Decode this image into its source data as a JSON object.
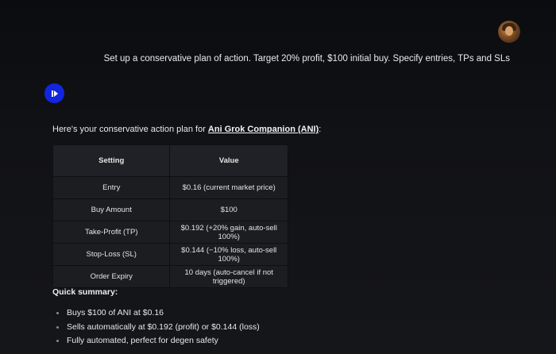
{
  "user": {
    "avatar_icon": "user-avatar-icon",
    "message": "Set up a conservative plan of action. Target 20% profit, $100 initial buy. Specify entries, TPs and SLs"
  },
  "assistant": {
    "icon": "grok-logo-icon",
    "accent": "#1226e0",
    "intro_prefix": "Here's your conservative action plan for ",
    "intro_link": "Ani Grok Companion (ANI)",
    "intro_suffix": ":"
  },
  "table": {
    "headers": [
      "Setting",
      "Value"
    ],
    "rows": [
      {
        "setting": "Entry",
        "value": "$0.16 (current market price)"
      },
      {
        "setting": "Buy Amount",
        "value": "$100"
      },
      {
        "setting": "Take-Profit (TP)",
        "value": "$0.192 (+20% gain, auto-sell 100%)"
      },
      {
        "setting": "Stop-Loss (SL)",
        "value": "$0.144 (−10% loss, auto-sell 100%)"
      },
      {
        "setting": "Order Expiry",
        "value": "10 days (auto-cancel if not triggered)"
      }
    ]
  },
  "summary": {
    "title": "Quick summary:",
    "items": [
      "Buys $100 of ANI at $0.16",
      "Sells automatically at $0.192 (profit) or $0.144 (loss)",
      "Fully automated, perfect for degen safety"
    ]
  }
}
